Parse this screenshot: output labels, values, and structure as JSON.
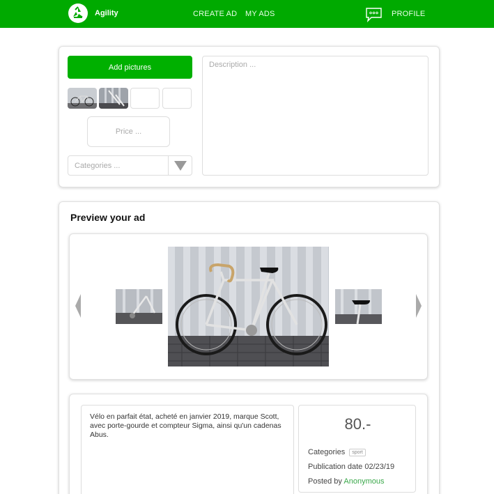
{
  "navbar": {
    "brand": "Agility",
    "links": {
      "create_ad": "CREATE AD",
      "my_ads": "MY ADS",
      "profile": "PROFILE"
    },
    "bg_color": "#00aa00",
    "icons": {
      "logo": "recycle-logo-icon",
      "chat": "chat-bubble-icon"
    }
  },
  "form": {
    "add_pictures_label": "Add pictures",
    "price_placeholder": "Price ...",
    "category_placeholder": "Categories ...",
    "description_placeholder": "Description ...",
    "thumbnails": [
      {
        "kind": "bike-photo"
      },
      {
        "kind": "bike-detail-photo"
      },
      {
        "kind": "empty"
      },
      {
        "kind": "empty"
      }
    ]
  },
  "preview": {
    "title": "Preview your ad",
    "description": "Vélo en parfait état, acheté en janvier 2019, marque Scott, avec porte-gourde et compteur Sigma, ainsi qu'un cadenas Abus.",
    "price": "80.-",
    "categories_label": "Categories",
    "category_tag": "sport",
    "publication_date": "Publication date 02/23/19",
    "posted_by_label": "Posted by",
    "author": "Anonymous"
  }
}
